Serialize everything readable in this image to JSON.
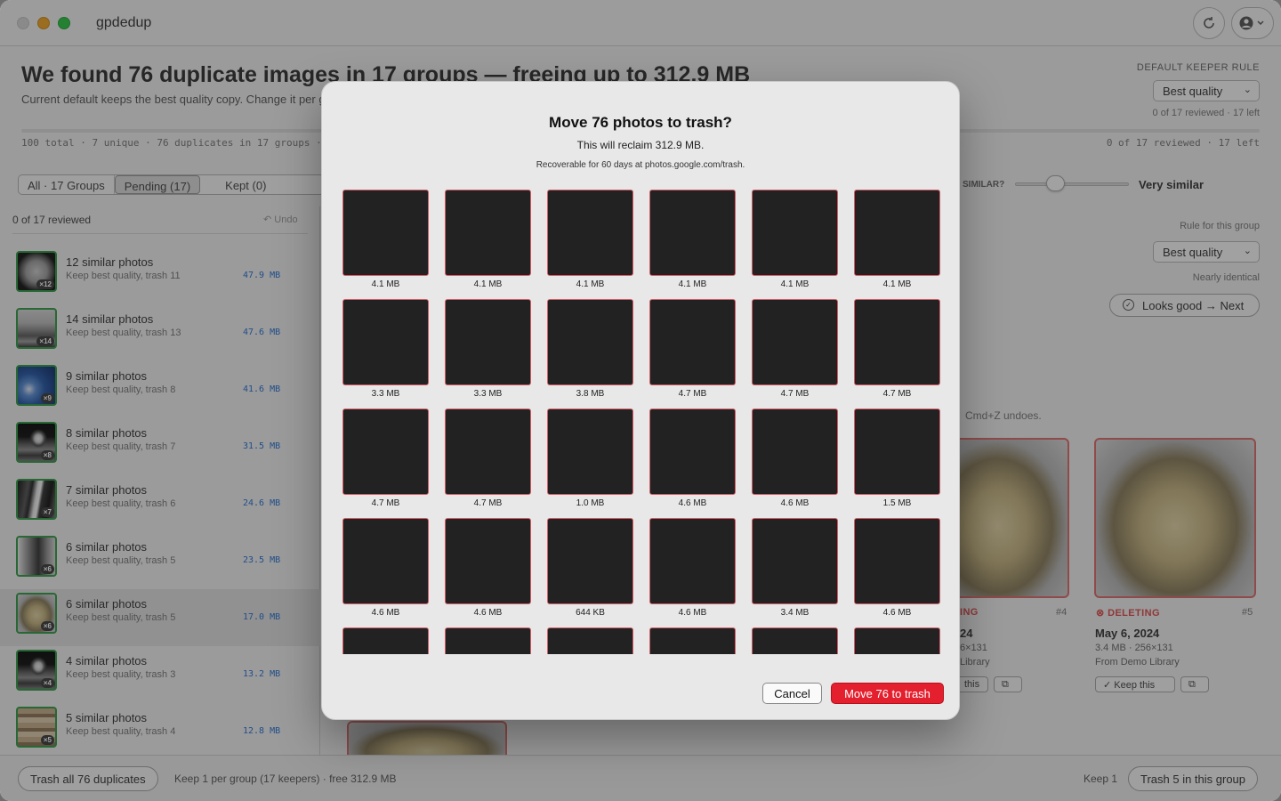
{
  "app": {
    "title": "gpdedup"
  },
  "header": {
    "headline": "We found 76 duplicate images in 17 groups — freeing up to 312.9 MB",
    "subhead": "Current default keeps the best quality copy. Change it per group.",
    "stats": "100 total · 7 unique · 76 duplicates in 17 groups ·",
    "stats_right": "0 of 17 reviewed · 17 left",
    "default_rule_label": "DEFAULT KEEPER RULE",
    "default_rule_value": "Best quality",
    "reviewed": "0 of 17 reviewed · 17 left"
  },
  "tabs": [
    {
      "label": "All · 17 Groups"
    },
    {
      "label": "Pending (17)"
    },
    {
      "label": "Kept (0)"
    }
  ],
  "sidebar": {
    "reviewed": "0 of 17 reviewed",
    "undo": "Undo",
    "groups": [
      {
        "title": "12 similar photos",
        "sub": "Keep best quality, trash 11",
        "size": "47.9 MB",
        "badge": "×12"
      },
      {
        "title": "14 similar photos",
        "sub": "Keep best quality, trash 13",
        "size": "47.6 MB",
        "badge": "×14"
      },
      {
        "title": "9 similar photos",
        "sub": "Keep best quality, trash 8",
        "size": "41.6 MB",
        "badge": "×9"
      },
      {
        "title": "8 similar photos",
        "sub": "Keep best quality, trash 7",
        "size": "31.5 MB",
        "badge": "×8"
      },
      {
        "title": "7 similar photos",
        "sub": "Keep best quality, trash 6",
        "size": "24.6 MB",
        "badge": "×7"
      },
      {
        "title": "6 similar photos",
        "sub": "Keep best quality, trash 5",
        "size": "23.5 MB",
        "badge": "×6"
      },
      {
        "title": "6 similar photos",
        "sub": "Keep best quality, trash 5",
        "size": "17.0 MB",
        "badge": "×6"
      },
      {
        "title": "4 similar photos",
        "sub": "Keep best quality, trash 3",
        "size": "13.2 MB",
        "badge": "×4"
      },
      {
        "title": "5 similar photos",
        "sub": "Keep best quality, trash 4",
        "size": "12.8 MB",
        "badge": "×5"
      }
    ]
  },
  "filter": {
    "similar_label": "SIMILAR?",
    "similar_value": "Very similar",
    "group_rule_label": "Rule for this group",
    "group_rule_value": "Best quality",
    "nearly": "Nearly identical",
    "looks_good": "Looks good → Next",
    "undo_hint": "Cmd+Z undoes."
  },
  "cards": {
    "c4": {
      "status": "ING",
      "num": "#4",
      "date": "24",
      "meta1": "6×131",
      "meta2": "Library",
      "keep": "this"
    },
    "c5": {
      "status": "DELETING",
      "num": "#5",
      "date": "May 6, 2024",
      "meta1": "3.4 MB · 256×131",
      "meta2": "From Demo Library",
      "keep": "Keep this"
    }
  },
  "footer": {
    "trash_all": "Trash all 76 duplicates",
    "keep_text": "Keep 1 per group (17 keepers) · free 312.9 MB",
    "keep1": "Keep 1",
    "trash_group": "Trash 5 in this group"
  },
  "modal": {
    "title": "Move 76 photos to trash?",
    "sub": "This will reclaim 312.9 MB.",
    "sub2": "Recoverable for 60 days at photos.google.com/trash.",
    "cancel": "Cancel",
    "confirm": "Move 76 to trash",
    "photos": [
      {
        "size": "4.1 MB",
        "kind": "p-lm"
      },
      {
        "size": "4.1 MB",
        "kind": "p-lm"
      },
      {
        "size": "4.1 MB",
        "kind": "p-lm"
      },
      {
        "size": "4.1 MB",
        "kind": "p-lm2"
      },
      {
        "size": "4.1 MB",
        "kind": "p-lm3"
      },
      {
        "size": "4.1 MB",
        "kind": "p-lm"
      },
      {
        "size": "3.3 MB",
        "kind": "p-shuttle"
      },
      {
        "size": "3.3 MB",
        "kind": "p-shuttle"
      },
      {
        "size": "3.8 MB",
        "kind": "p-earth"
      },
      {
        "size": "4.7 MB",
        "kind": "p-mars"
      },
      {
        "size": "4.7 MB",
        "kind": "p-rover"
      },
      {
        "size": "4.7 MB",
        "kind": "p-mars"
      },
      {
        "size": "4.7 MB",
        "kind": "p-mars"
      },
      {
        "size": "4.7 MB",
        "kind": "p-mars"
      },
      {
        "size": "1.0 MB",
        "kind": "p-astro"
      },
      {
        "size": "4.6 MB",
        "kind": "p-astro"
      },
      {
        "size": "4.6 MB",
        "kind": "p-astro"
      },
      {
        "size": "1.5 MB",
        "kind": "p-astro"
      },
      {
        "size": "4.6 MB",
        "kind": "p-astro"
      },
      {
        "size": "4.6 MB",
        "kind": "p-astro"
      },
      {
        "size": "644 KB",
        "kind": "p-astro"
      },
      {
        "size": "4.6 MB",
        "kind": "p-astro"
      },
      {
        "size": "3.4 MB",
        "kind": "p-astro"
      },
      {
        "size": "4.6 MB",
        "kind": "p-astro"
      },
      {
        "size": "",
        "kind": "p-astro"
      },
      {
        "size": "",
        "kind": "p-moon"
      },
      {
        "size": "",
        "kind": "p-astro"
      },
      {
        "size": "",
        "kind": "p-jup"
      },
      {
        "size": "",
        "kind": "p-jup"
      },
      {
        "size": "",
        "kind": "p-jup"
      }
    ]
  }
}
